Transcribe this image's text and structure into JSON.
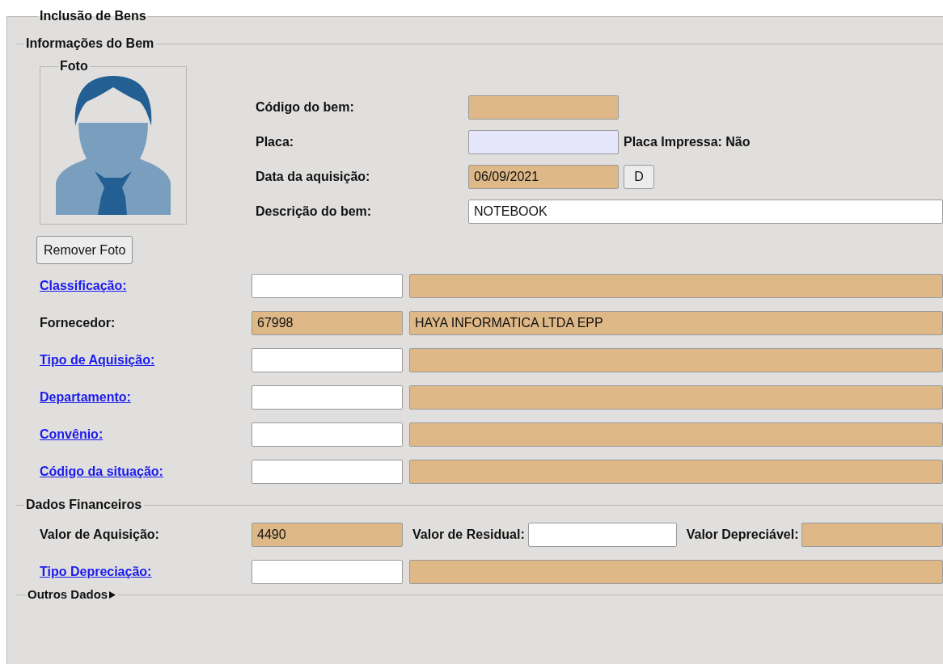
{
  "form": {
    "title": "Inclusão de Bens"
  },
  "info_section": {
    "title": "Informações do Bem",
    "photo": {
      "title": "Foto",
      "remove_button": "Remover Foto"
    },
    "top_fields": [
      {
        "label": "Código do bem:",
        "kind": "readonly"
      },
      {
        "label": "Placa:",
        "kind": "highlighted",
        "note": "Placa Impressa: Não"
      },
      {
        "label": "Data da aquisição:",
        "value": "06/09/2021",
        "kind": "readonly",
        "button": "D"
      },
      {
        "label": "Descrição do bem:",
        "value": "NOTEBOOK",
        "kind": "editable",
        "wide": true
      }
    ],
    "lookup_rows": [
      {
        "label": "Classificação:",
        "link": true,
        "code_readonly": false
      },
      {
        "label": "Fornecedor:",
        "link": false,
        "code": "67998",
        "code_readonly": true,
        "description": "HAYA INFORMATICA LTDA EPP"
      },
      {
        "label": "Tipo de Aquisição:",
        "link": true,
        "code_readonly": false
      },
      {
        "label": "Departamento:",
        "link": true,
        "code_readonly": false
      },
      {
        "label": "Convênio:",
        "link": true,
        "code_readonly": false
      },
      {
        "label": "Código da situação:",
        "link": true,
        "code_readonly": false
      }
    ]
  },
  "financial_section": {
    "title": "Dados Financeiros",
    "values": [
      {
        "label": "Valor de Aquisição:",
        "value": "4490",
        "kind": "readonly"
      },
      {
        "label": "Valor de Residual:",
        "kind": "editable"
      },
      {
        "label": "Valor Depreciável:",
        "kind": "readonly"
      }
    ],
    "depreciation": {
      "label": "Tipo Depreciação:",
      "link": true,
      "code_readonly": false
    }
  },
  "other_section": {
    "title": "Outros Dados",
    "expanded": false
  }
}
